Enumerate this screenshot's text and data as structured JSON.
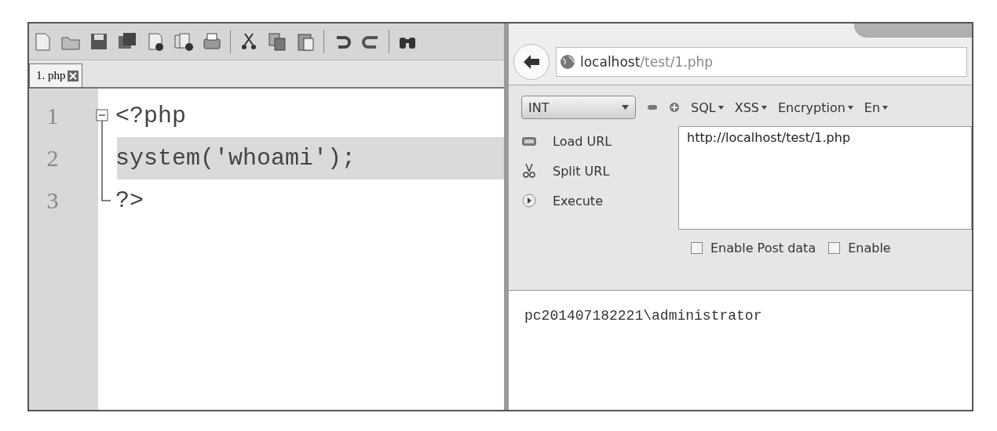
{
  "editor": {
    "tabs": [
      {
        "label": "1. php",
        "selected": true
      }
    ],
    "lines": [
      {
        "number": "1",
        "text": "<?php",
        "kind": "fold-start",
        "current": false
      },
      {
        "number": "2",
        "text": "system('whoami');",
        "kind": "fold-body",
        "current": true
      },
      {
        "number": "3",
        "text": "?>",
        "kind": "fold-end",
        "current": false
      }
    ]
  },
  "browser": {
    "address": {
      "host": "localhost",
      "path": "/test/1.php"
    },
    "hackbar": {
      "dropdown": "INT",
      "menus": [
        "SQL",
        "XSS",
        "Encryption",
        "En"
      ],
      "actions": [
        {
          "label": "Load URL",
          "kind": "load"
        },
        {
          "label": "Split URL",
          "kind": "split"
        },
        {
          "label": "Execute",
          "kind": "execute"
        }
      ],
      "url_value": "http://localhost/test/1.php",
      "options": [
        {
          "label": "Enable Post data",
          "checked": false
        },
        {
          "label": "Enable",
          "checked": false
        }
      ]
    },
    "output": "pc201407182221\\administrator"
  }
}
